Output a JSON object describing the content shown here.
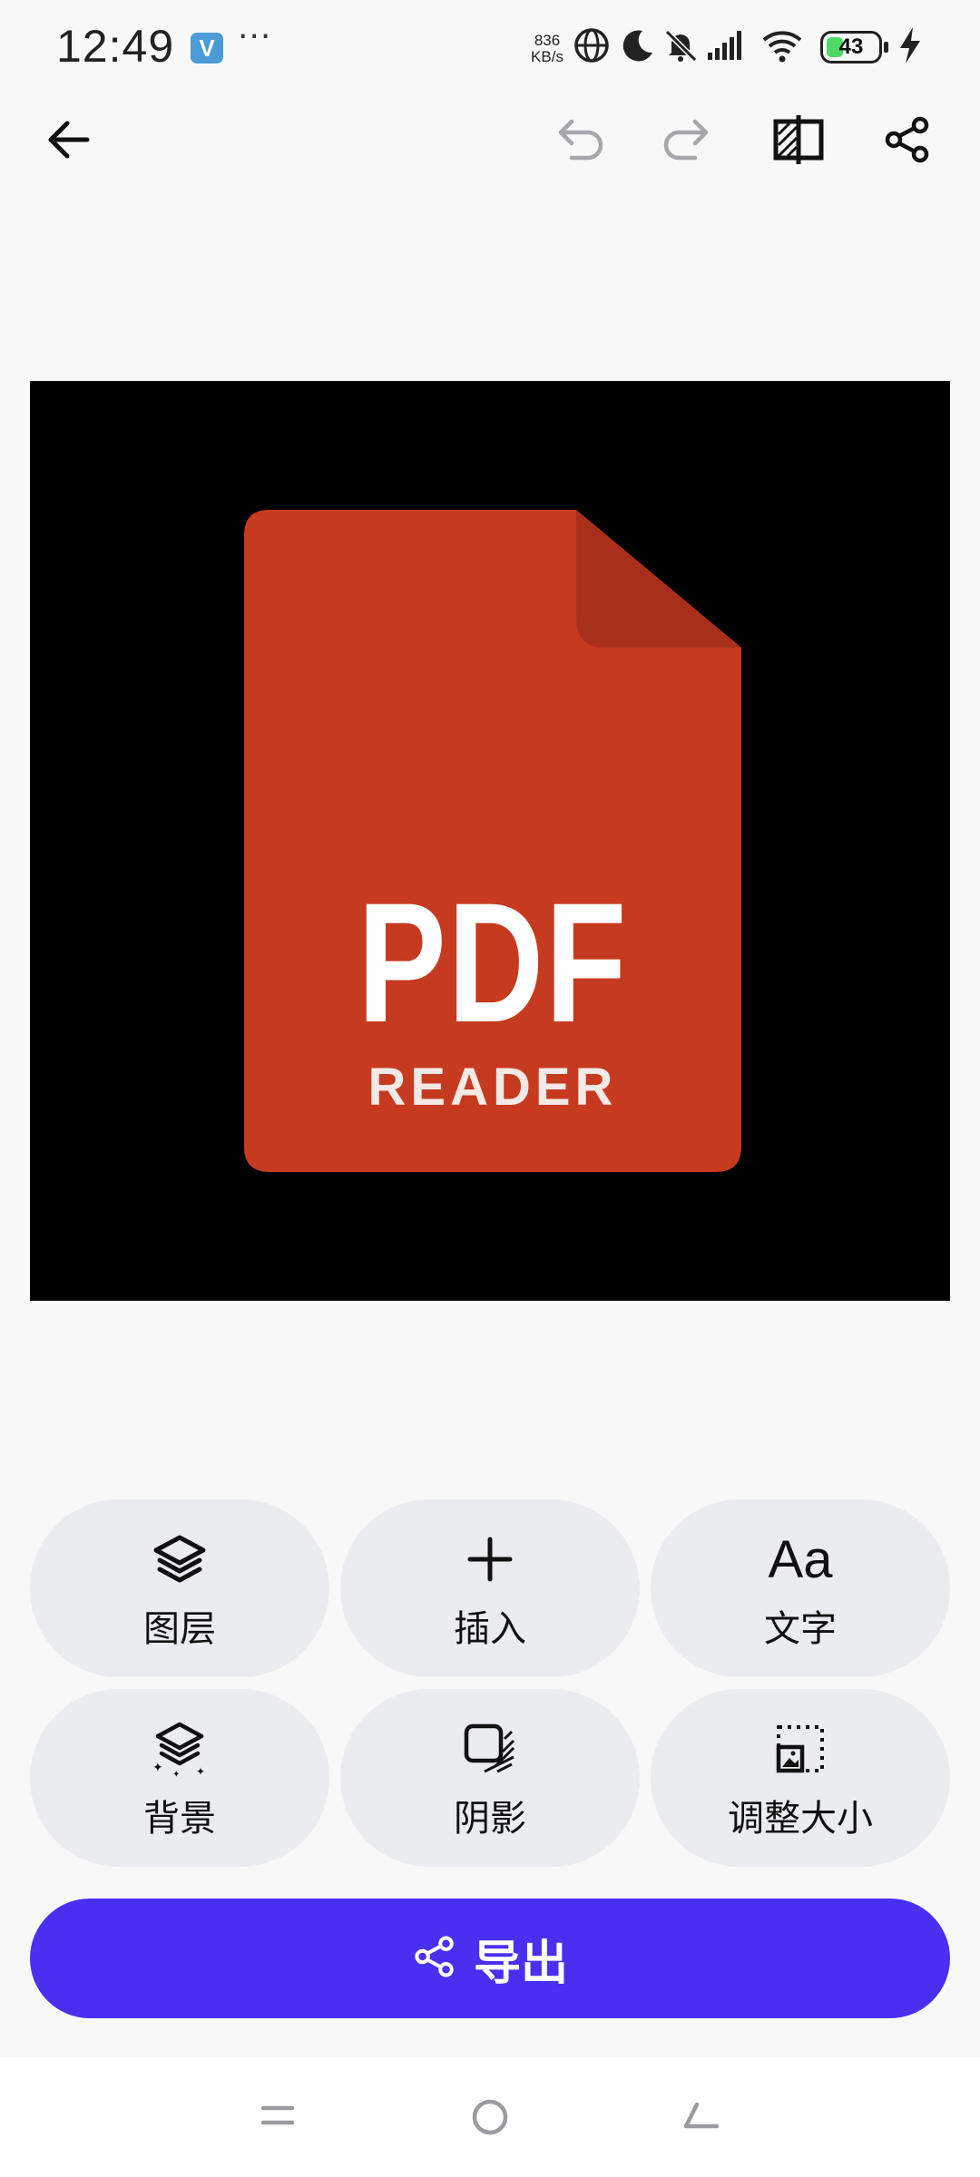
{
  "status_bar": {
    "time": "12:49",
    "app_badge": "V",
    "more": "···",
    "net_speed_value": "836",
    "net_speed_unit": "KB/s",
    "battery": "43",
    "icons": [
      "globe-icon",
      "moon-icon",
      "mute-bell-icon",
      "signal-icon",
      "wifi-icon",
      "battery-icon",
      "charging-icon"
    ]
  },
  "toolbar": {
    "icons": [
      "back-arrow-icon",
      "undo-icon",
      "redo-icon",
      "compare-icon",
      "share-icon"
    ]
  },
  "canvas": {
    "background": "#000000",
    "doc_color": "#c63a1f",
    "title": "PDF",
    "subtitle": "READER"
  },
  "tools": [
    {
      "label": "图层",
      "icon": "layers-icon"
    },
    {
      "label": "插入",
      "icon": "plus-icon"
    },
    {
      "label": "文字",
      "icon": "text-icon",
      "glyph": "Aa"
    },
    {
      "label": "背景",
      "icon": "background-icon"
    },
    {
      "label": "阴影",
      "icon": "shadow-icon"
    },
    {
      "label": "调整大小",
      "icon": "resize-icon"
    }
  ],
  "export": {
    "label": "导出",
    "color": "#4a2ff0"
  },
  "nav_bar": {
    "icons": [
      "menu-icon",
      "home-icon",
      "back-icon"
    ]
  }
}
